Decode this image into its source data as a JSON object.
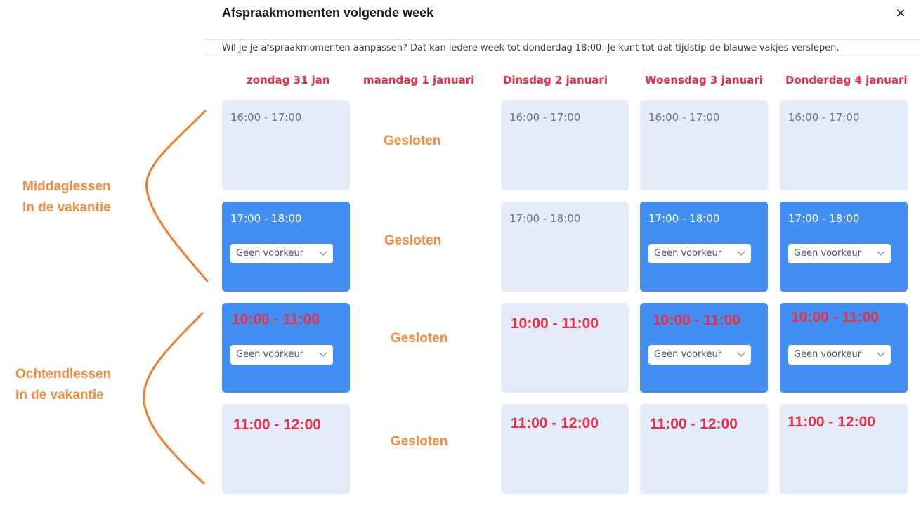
{
  "modal": {
    "title": "Afspraakmomenten volgende week",
    "close_label": "×",
    "subtitle": "Wil je je afspraakmomenten aanpassen? Dat kan iedere week tot donderdag 18:00. Je kunt tot dat tijdstip de blauwe vakjes verslepen."
  },
  "days": [
    {
      "header": "zondag 31 jan"
    },
    {
      "header": "maandag 1 januari"
    },
    {
      "header": "Dinsdag 2 januari"
    },
    {
      "header": "Woensdag 3 januari"
    },
    {
      "header": "Donderdag 4 januari"
    }
  ],
  "annotations": {
    "afternoon_line1": "Middaglessen",
    "afternoon_line2": "In de vakantie",
    "morning_line1": "Ochtendlessen",
    "morning_line2": "In de vakantie",
    "closed": "Gesloten",
    "accent_color": "#f48a3d",
    "header_color": "#ef2b3f"
  },
  "slots": {
    "sun_1600": "16:00 - 17:00",
    "sun_1700": "17:00 - 18:00",
    "sun_1000": "10:00 - 11:00",
    "sun_1100": "11:00 - 12:00",
    "tue_1600": "16:00 - 17:00",
    "tue_1700": "17:00 - 18:00",
    "tue_1000": "10:00 - 11:00",
    "tue_1100": "11:00 - 12:00",
    "wed_1600": "16:00 - 17:00",
    "wed_1700": "17:00 - 18:00",
    "wed_1000": "10:00 - 11:00",
    "wed_1100": "11:00 - 12:00",
    "thu_1600": "16:00 - 17:00",
    "thu_1700": "17:00 - 18:00",
    "thu_1000": "10:00 - 11:00",
    "thu_1100": "11:00 - 12:00"
  },
  "preference": {
    "selected": "Geen voorkeur"
  },
  "colors": {
    "slot_light": "#e3ecfa",
    "slot_active": "#428ef2"
  }
}
